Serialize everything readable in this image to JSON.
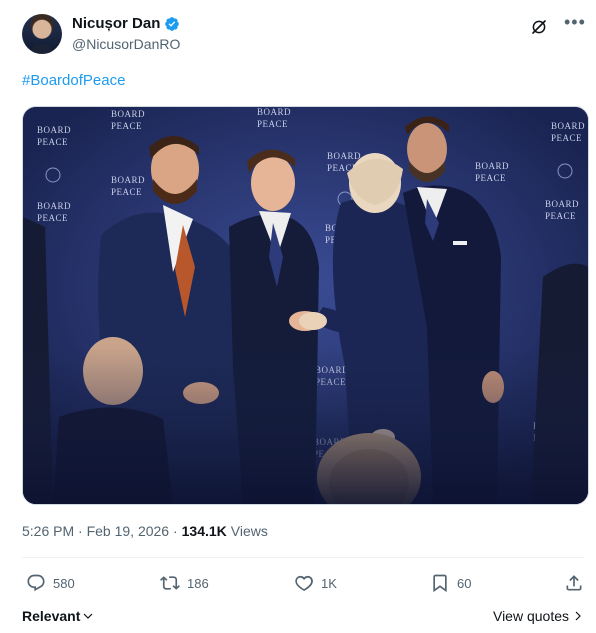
{
  "post": {
    "author": {
      "display_name": "Nicușor Dan",
      "handle": "@NicusorDanRO",
      "verified": true
    },
    "text": "#BoardofPeace",
    "media": {
      "backdrop_sign_lines": [
        "BOARD",
        "PEACE"
      ]
    },
    "timestamp": "5:26 PM · Feb 19, 2026 ·",
    "views_count": "134.1K",
    "views_label": "Views"
  },
  "actions": {
    "reply_count": "580",
    "repost_count": "186",
    "like_count": "1K",
    "bookmark_count": "60"
  },
  "replies_bar": {
    "sort_label": "Relevant",
    "view_quotes_label": "View quotes"
  },
  "icons": {
    "verified": "verified-badge-icon",
    "grok": "grok-icon",
    "more": "more-icon",
    "reply": "reply-icon",
    "repost": "repost-icon",
    "like": "heart-icon",
    "bookmark": "bookmark-icon",
    "share": "share-icon"
  },
  "colors": {
    "accent": "#1d9bf0",
    "secondary_text": "#536471",
    "primary_text": "#0f1419"
  }
}
